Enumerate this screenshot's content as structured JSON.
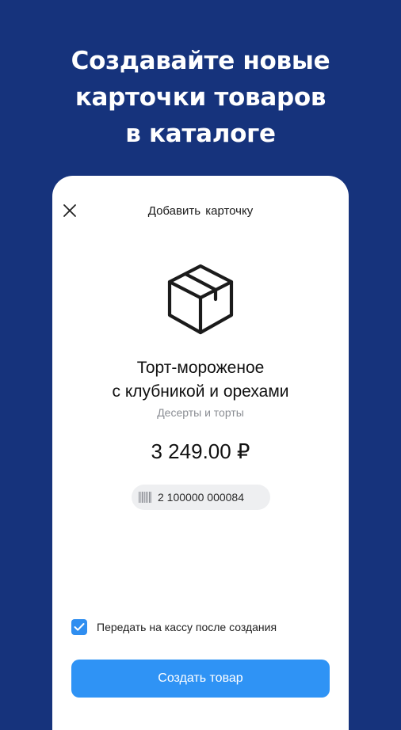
{
  "promo": {
    "line1": "Создавайте новые",
    "line2": "карточки товаров",
    "line3": "в каталоге"
  },
  "screen": {
    "title": "Добавить  карточку",
    "close_icon": "close-icon"
  },
  "product": {
    "icon": "box-icon",
    "name_line1": "Торт-мороженое",
    "name_line2": "с клубникой и орехами",
    "category": "Десерты и торты",
    "price": "3 249.00 ₽",
    "barcode_icon": "barcode-icon",
    "barcode": "2 100000 000084"
  },
  "options": {
    "send_to_register_label": "Передать на кассу после создания",
    "send_to_register_checked": true
  },
  "actions": {
    "create_label": "Создать товар"
  },
  "colors": {
    "background": "#16337c",
    "accent": "#2f93f5",
    "checkbox": "#2f8ef0",
    "chip": "#eeeff1"
  }
}
